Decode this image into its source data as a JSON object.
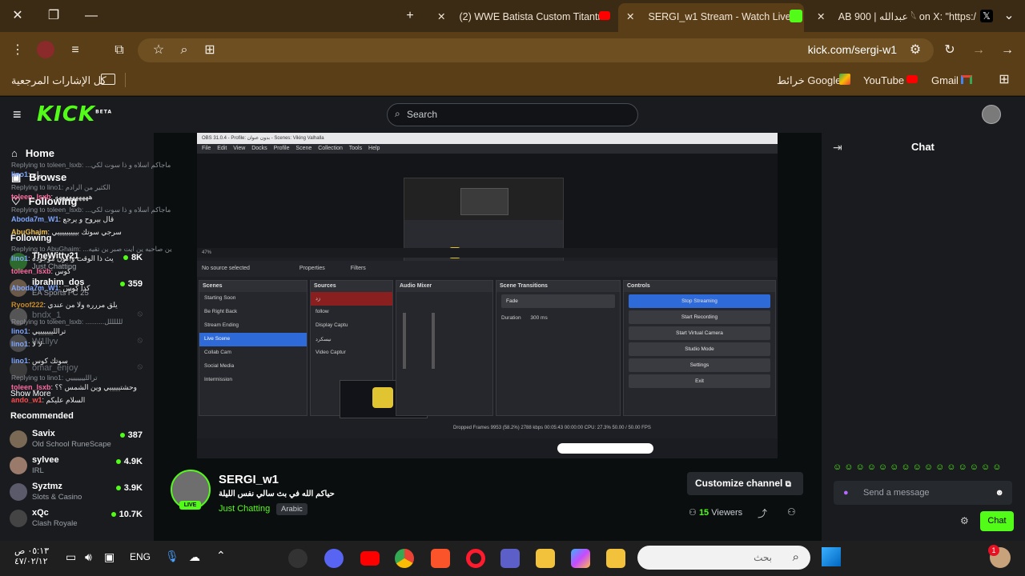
{
  "browser": {
    "tabs": [
      {
        "title": "(2) WWE Batista Custom Titantr",
        "fav_color": "#ff0000"
      },
      {
        "title": "SERGI_w1 Stream - Watch Live",
        "fav_color": "#53fc18"
      },
      {
        "title": "AB 900 | عبدالله 𓆩 on X: \"https:/",
        "fav_color": "#111111"
      }
    ],
    "url": "kick.com/sergi-w1",
    "bookmarks": {
      "all_label": "كل الإشارات المرجعية",
      "items": [
        {
          "label": "Gmail"
        },
        {
          "label": "YouTube"
        },
        {
          "label": "خرائط Google"
        }
      ]
    }
  },
  "kick": {
    "logo": "KICK",
    "logo_badge": "BETA",
    "search_placeholder": "Search",
    "nav": [
      {
        "label": "Home"
      },
      {
        "label": "Browse"
      },
      {
        "label": "Following"
      }
    ],
    "following_title": "Following",
    "following": [
      {
        "name": "TheWitty21",
        "category": "Just Chatting",
        "viewers": "8K",
        "live": true
      },
      {
        "name": "ibrahim_dos",
        "category": "EA Sports FC 25",
        "viewers": "359",
        "live": true
      },
      {
        "name": "bndx_1",
        "live": false
      },
      {
        "name": "W1llyv",
        "live": false
      },
      {
        "name": "omar_enjoy",
        "live": false
      }
    ],
    "show_more": "Show More",
    "recommended_title": "Recommended",
    "recommended": [
      {
        "name": "Savix",
        "category": "Old School RuneScape",
        "viewers": "387"
      },
      {
        "name": "sylvee",
        "category": "IRL",
        "viewers": "4.9K"
      },
      {
        "name": "Syztmz",
        "category": "Slots & Casino",
        "viewers": "3.9K"
      },
      {
        "name": "xQc",
        "category": "Clash Royale",
        "viewers": "10.7K"
      }
    ]
  },
  "stream": {
    "channel": "SERGI_w1",
    "title": "حياكم الله في بث سالي نفس الليلة",
    "category": "Just Chatting",
    "tag": "Arabic",
    "live_label": "LIVE",
    "viewers": "15",
    "viewers_label": "Viewers",
    "customize_label": "Customize channel"
  },
  "obs": {
    "title": "OBS 31.0.4 - Profile: بدون عنوان - Scenes: Viking Valhalla",
    "menu": "File Edit View Docks Profile Scene Collection Tools Help",
    "no_source": "No source selected",
    "properties": "Properties",
    "filters": "Filters",
    "scenes_title": "Scenes",
    "scenes": [
      "Starting Soon",
      "Be Right Back",
      "Stream Ending",
      "Live Scene",
      "Collab Cam",
      "Social Media",
      "Intermission"
    ],
    "active_scene": "Live Scene",
    "sources_title": "Sources",
    "sources": [
      "زد",
      "follow",
      "Display Captu",
      "نيسكرد",
      "Video Captur"
    ],
    "mixer_title": "Audio Mixer",
    "transitions_title": "Scene Transitions",
    "transition": "Fade",
    "duration_label": "Duration",
    "duration": "300 ms",
    "controls_title": "Controls",
    "controls": [
      "Stop Streaming",
      "Start Recording",
      "Start Virtual Camera",
      "Studio Mode",
      "Settings",
      "Exit"
    ],
    "status": "Dropped Frames 9953 (58.2%)   2788 kbps   00:05:43   00:00:00   CPU: 27.3%   50.00 / 50.00 FPS"
  },
  "chat": {
    "title": "Chat",
    "messages": [
      {
        "reply": "Replying to toleen_lsxb: ...ماجاكم اسلاه و ذا سوت لكي",
        "user": "lino1",
        "text": "راح",
        "cls": "u1"
      },
      {
        "reply": "Replying to lino1: الكثير من الرادم",
        "user": "toleen_lsxb",
        "text": "ههههههههههه",
        "cls": "u2"
      },
      {
        "reply": "Replying to toleen_lsxb: ...ماجاكم اسلاه و ذا سوت لكي",
        "user": "Aboda7m_W1",
        "text": "قال بيروح و يرجع",
        "cls": "u1"
      },
      {
        "reply": "",
        "user": "AbuGhaim",
        "text": "سرجي سوتك بيييييييييي",
        "cls": "u3"
      },
      {
        "reply": "Replying to AbuGhaim: ...ين صاحبه ين ايت صبر ين تقيه",
        "user": "lino1",
        "text": "يث ذا الوقت واكون موجوده",
        "cls": "u1"
      },
      {
        "reply": "",
        "user": "toleen_lsxb",
        "text": "كوس",
        "cls": "u2"
      },
      {
        "reply": "",
        "user": "Aboda7m_W1",
        "text": "كذا كوس",
        "cls": "u1"
      },
      {
        "reply": "",
        "user": "Ryoof222",
        "text": "يلق مررره ولا من عندي",
        "cls": "u4"
      },
      {
        "reply": "Replying to toleen_lsxb: ..........للللللل",
        "user": "lino1",
        "text": "ترالليييييييي",
        "cls": "u1"
      },
      {
        "reply": "",
        "user": "lino1",
        "text": "لا لا",
        "cls": "u1"
      },
      {
        "reply": "",
        "user": "lino1",
        "text": "سوتك كوس",
        "cls": "u1"
      },
      {
        "reply": "Replying to lino1: ترالليييييييي",
        "user": "toleen_lsxb",
        "text": "وحشتيييييي وين الشمس ؟؟",
        "cls": "u2"
      },
      {
        "reply": "",
        "user": "ando_w1",
        "text": "السلام عليكم",
        "cls": "u5"
      }
    ],
    "input_placeholder": "Send a message",
    "send_label": "Chat"
  },
  "taskbar": {
    "time": "٠٥:١٣ ص",
    "date": "٤٧/٠٢/١٢",
    "lang": "ENG",
    "search_placeholder": "بحث",
    "notif_count": "1"
  }
}
